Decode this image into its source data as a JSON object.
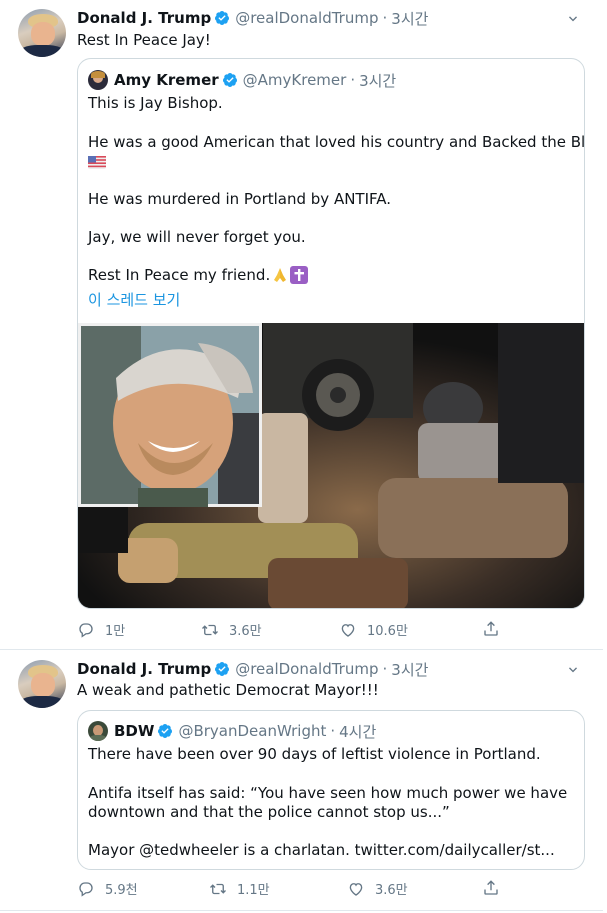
{
  "tweets": [
    {
      "author": {
        "name": "Donald J. Trump",
        "handle": "@realDonaldTrump",
        "time": "3시간"
      },
      "text": "Rest In Peace Jay!",
      "quote": {
        "author": {
          "name": "Amy Kremer",
          "handle": "@AmyKremer",
          "time": "3시간"
        },
        "lines": [
          "This is Jay Bishop.",
          "He was a good American that loved his country and Backed the Blue.",
          "He was murdered in Portland by ANTIFA.",
          "Jay, we will never forget you.",
          "Rest In Peace my friend."
        ],
        "thread_link": "이 스레드 보기"
      },
      "actions": {
        "reply": "1만",
        "retweet": "3.6만",
        "like": "10.6만"
      }
    },
    {
      "author": {
        "name": "Donald J. Trump",
        "handle": "@realDonaldTrump",
        "time": "3시간"
      },
      "text": "A weak and pathetic Democrat Mayor!!!",
      "quote": {
        "author": {
          "name": "BDW",
          "handle": "@BryanDeanWright",
          "time": "4시간"
        },
        "lines": [
          "There have been over 90 days of leftist violence in Portland.",
          "Antifa itself has said: “You have seen how much power we have",
          "downtown and that the police cannot stop us...”",
          "Mayor @tedwheeler is a charlatan. twitter.com/dailycaller/st..."
        ]
      },
      "actions": {
        "reply": "5.9천",
        "retweet": "1.1만",
        "like": "3.6만"
      }
    }
  ],
  "icons": {
    "verified": "verified-badge-icon",
    "chevron": "chevron-down-icon",
    "reply": "reply-icon",
    "retweet": "retweet-icon",
    "like": "heart-icon",
    "share": "share-icon"
  },
  "colors": {
    "accent": "#1da1f2",
    "link": "#1b95e0",
    "muted": "#657786",
    "border": "#e1e8ed"
  }
}
